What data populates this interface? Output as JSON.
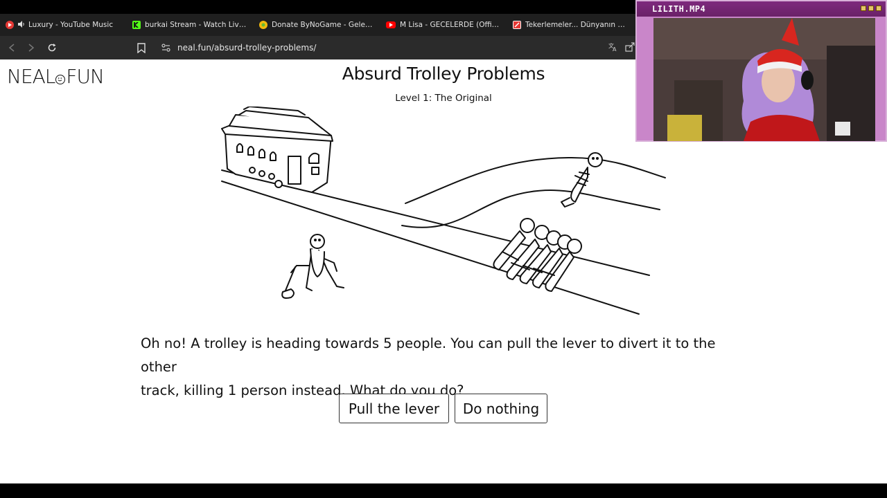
{
  "browser": {
    "tabs": [
      {
        "title": "Luxury - YouTube Music",
        "favicon": "youtube-music-icon",
        "color": "#e53935",
        "audio": true
      },
      {
        "title": "burkai Stream - Watch Live on K",
        "favicon": "kick-icon",
        "color": "#53fc18",
        "audio": false
      },
      {
        "title": "Donate ByNoGame - Gelen/Gide",
        "favicon": "bynogame-icon",
        "color": "#f2b90c",
        "audio": false
      },
      {
        "title": "M Lisa - GECELERDE (Official Lyr",
        "favicon": "youtube-icon",
        "color": "#ff0000",
        "audio": false
      },
      {
        "title": "Tekerlemeler... Dünyanın En Zor",
        "favicon": "site-icon",
        "color": "#e53935",
        "audio": false
      }
    ],
    "url": "neal.fun/absurd-trolley-problems/"
  },
  "page": {
    "logo_left": "NEAL",
    "logo_right": "FUN",
    "title": "Absurd Trolley Problems",
    "subtitle": "Level 1: The Original",
    "question_line1": "Oh no! A trolley is heading towards 5 people. You can pull the lever to divert it to the other",
    "question_line2": "track, killing 1 person instead. What do you do?",
    "btn_pull": "Pull the lever",
    "btn_nothing": "Do nothing"
  },
  "webcam": {
    "title": "LILITH.MP4"
  }
}
